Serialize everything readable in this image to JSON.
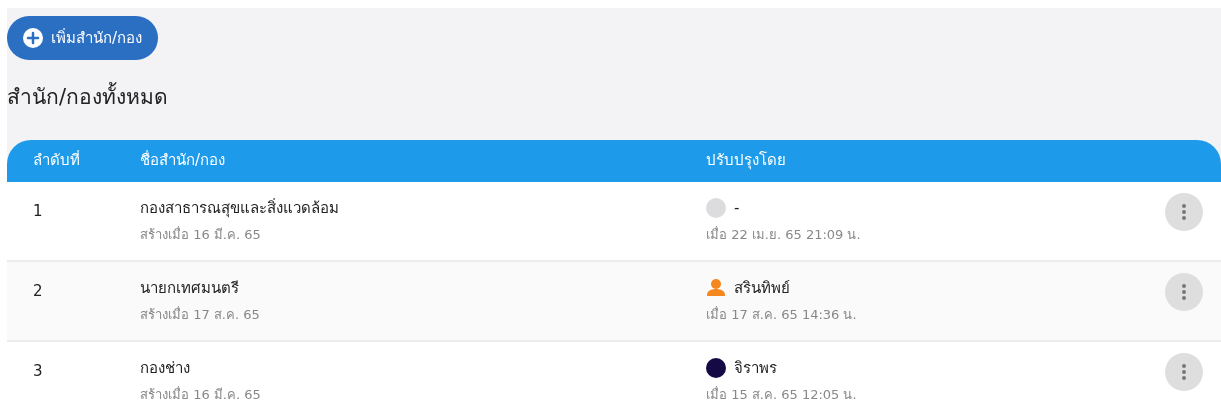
{
  "add_button": {
    "label": "เพิ่มสำนัก/กอง"
  },
  "heading": "สำนัก/กองทั้งหมด",
  "table": {
    "columns": [
      "ลำดับที่",
      "ชื่อสำนัก/กอง",
      "ปรับปรุงโดย"
    ],
    "rows": [
      {
        "number": "1",
        "name": "กองสาธารณสุขและสิ่งแวดล้อม",
        "created": "สร้างเมื่อ 16 มี.ค. 65",
        "updated_by": "-",
        "avatar": {
          "kind": "blank",
          "color": "#dcdcdf"
        },
        "updated_at": "เมื่อ 22 เม.ย. 65 21:09 น."
      },
      {
        "number": "2",
        "name": "นายกเทศมนตรี",
        "created": "สร้างเมื่อ 17 ส.ค. 65",
        "updated_by": "สรินทิพย์",
        "avatar": {
          "kind": "person",
          "color": "#f5871f"
        },
        "updated_at": "เมื่อ 17 ส.ค. 65 14:36 น."
      },
      {
        "number": "3",
        "name": "กองช่าง",
        "created": "สร้างเมื่อ 16 มี.ค. 65",
        "updated_by": "จิราพร",
        "avatar": {
          "kind": "dot",
          "color": "#150a45"
        },
        "updated_at": "เมื่อ 15 ส.ค. 65 12:05 น."
      }
    ]
  }
}
